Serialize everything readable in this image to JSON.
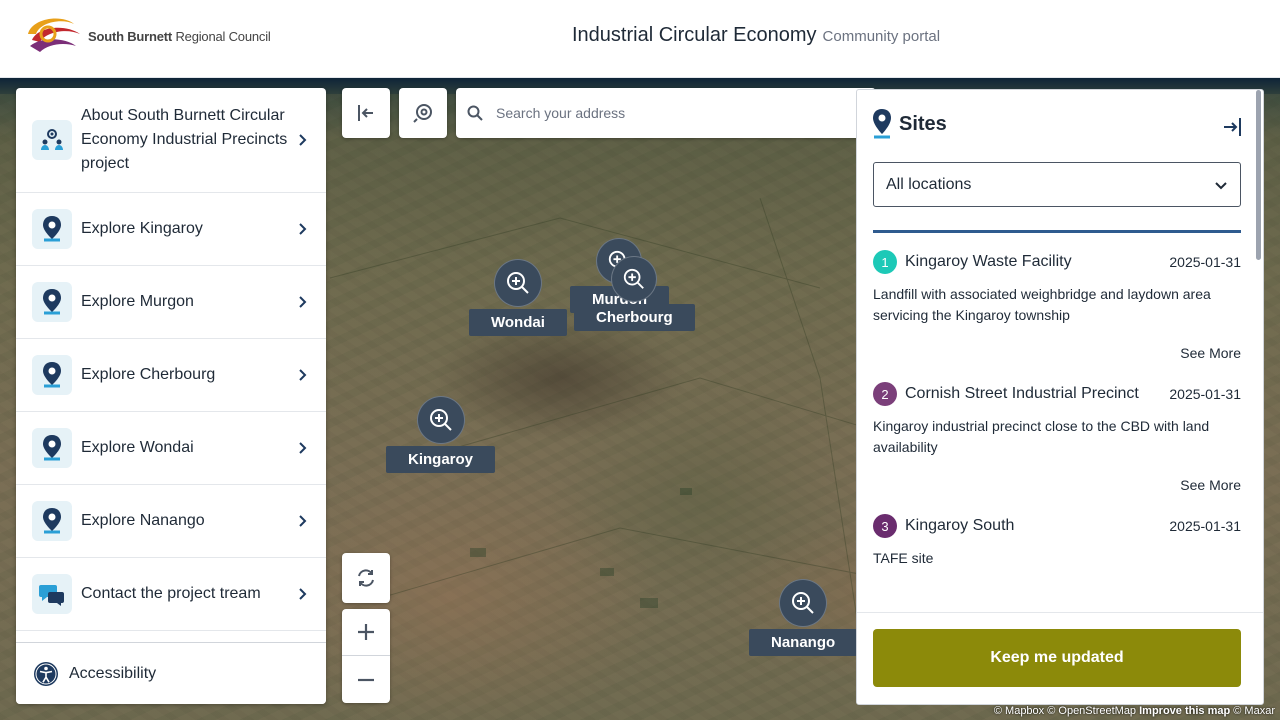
{
  "header": {
    "org_name_bold": "South Burnett",
    "org_name_rest": "Regional Council",
    "title": "Industrial Circular Economy",
    "subtitle": "Community portal"
  },
  "sidebar": {
    "items": [
      {
        "label": "About South Burnett Circular Economy Industrial Precincts project",
        "icon": "people-location-icon"
      },
      {
        "label": "Explore Kingaroy",
        "icon": "map-pin-icon"
      },
      {
        "label": "Explore Murgon",
        "icon": "map-pin-icon"
      },
      {
        "label": "Explore Cherbourg",
        "icon": "map-pin-icon"
      },
      {
        "label": "Explore Wondai",
        "icon": "map-pin-icon"
      },
      {
        "label": "Explore Nanango",
        "icon": "map-pin-icon"
      },
      {
        "label": "Contact the project tream",
        "icon": "chat-bubbles-icon"
      }
    ],
    "accessibility_label": "Accessibility"
  },
  "search": {
    "placeholder": "Search your address"
  },
  "markers": [
    {
      "label": "Wondai"
    },
    {
      "label": "Murgon"
    },
    {
      "label": "Cherbourg"
    },
    {
      "label": "Kingaroy"
    },
    {
      "label": "Nanango"
    }
  ],
  "sites_panel": {
    "title": "Sites",
    "filter_value": "All locations",
    "see_more_label": "See More",
    "sites": [
      {
        "number": "1",
        "name": "Kingaroy Waste Facility",
        "date": "2025-01-31",
        "description": "Landfill with associated weighbridge and laydown area servicing the Kingaroy township",
        "color": "#1dc9b7"
      },
      {
        "number": "2",
        "name": "Cornish Street Industrial Precinct",
        "date": "2025-01-31",
        "description": "Kingaroy industrial precinct close to the CBD with land availability",
        "color": "#7b3f7a"
      },
      {
        "number": "3",
        "name": "Kingaroy South",
        "date": "2025-01-31",
        "description": "TAFE site",
        "color": "#6a2c6e"
      }
    ],
    "cta_label": "Keep me updated",
    "cta_color": "#8c8a0a"
  },
  "attribution": {
    "mapbox": "© Mapbox",
    "osm": "© OpenStreetMap",
    "improve": "Improve this map",
    "maxar": "© Maxar"
  },
  "colors": {
    "accent": "#2f5b8f",
    "marker_bg": "#3a4a5c",
    "icon_tile_bg": "#e6f2f7"
  }
}
